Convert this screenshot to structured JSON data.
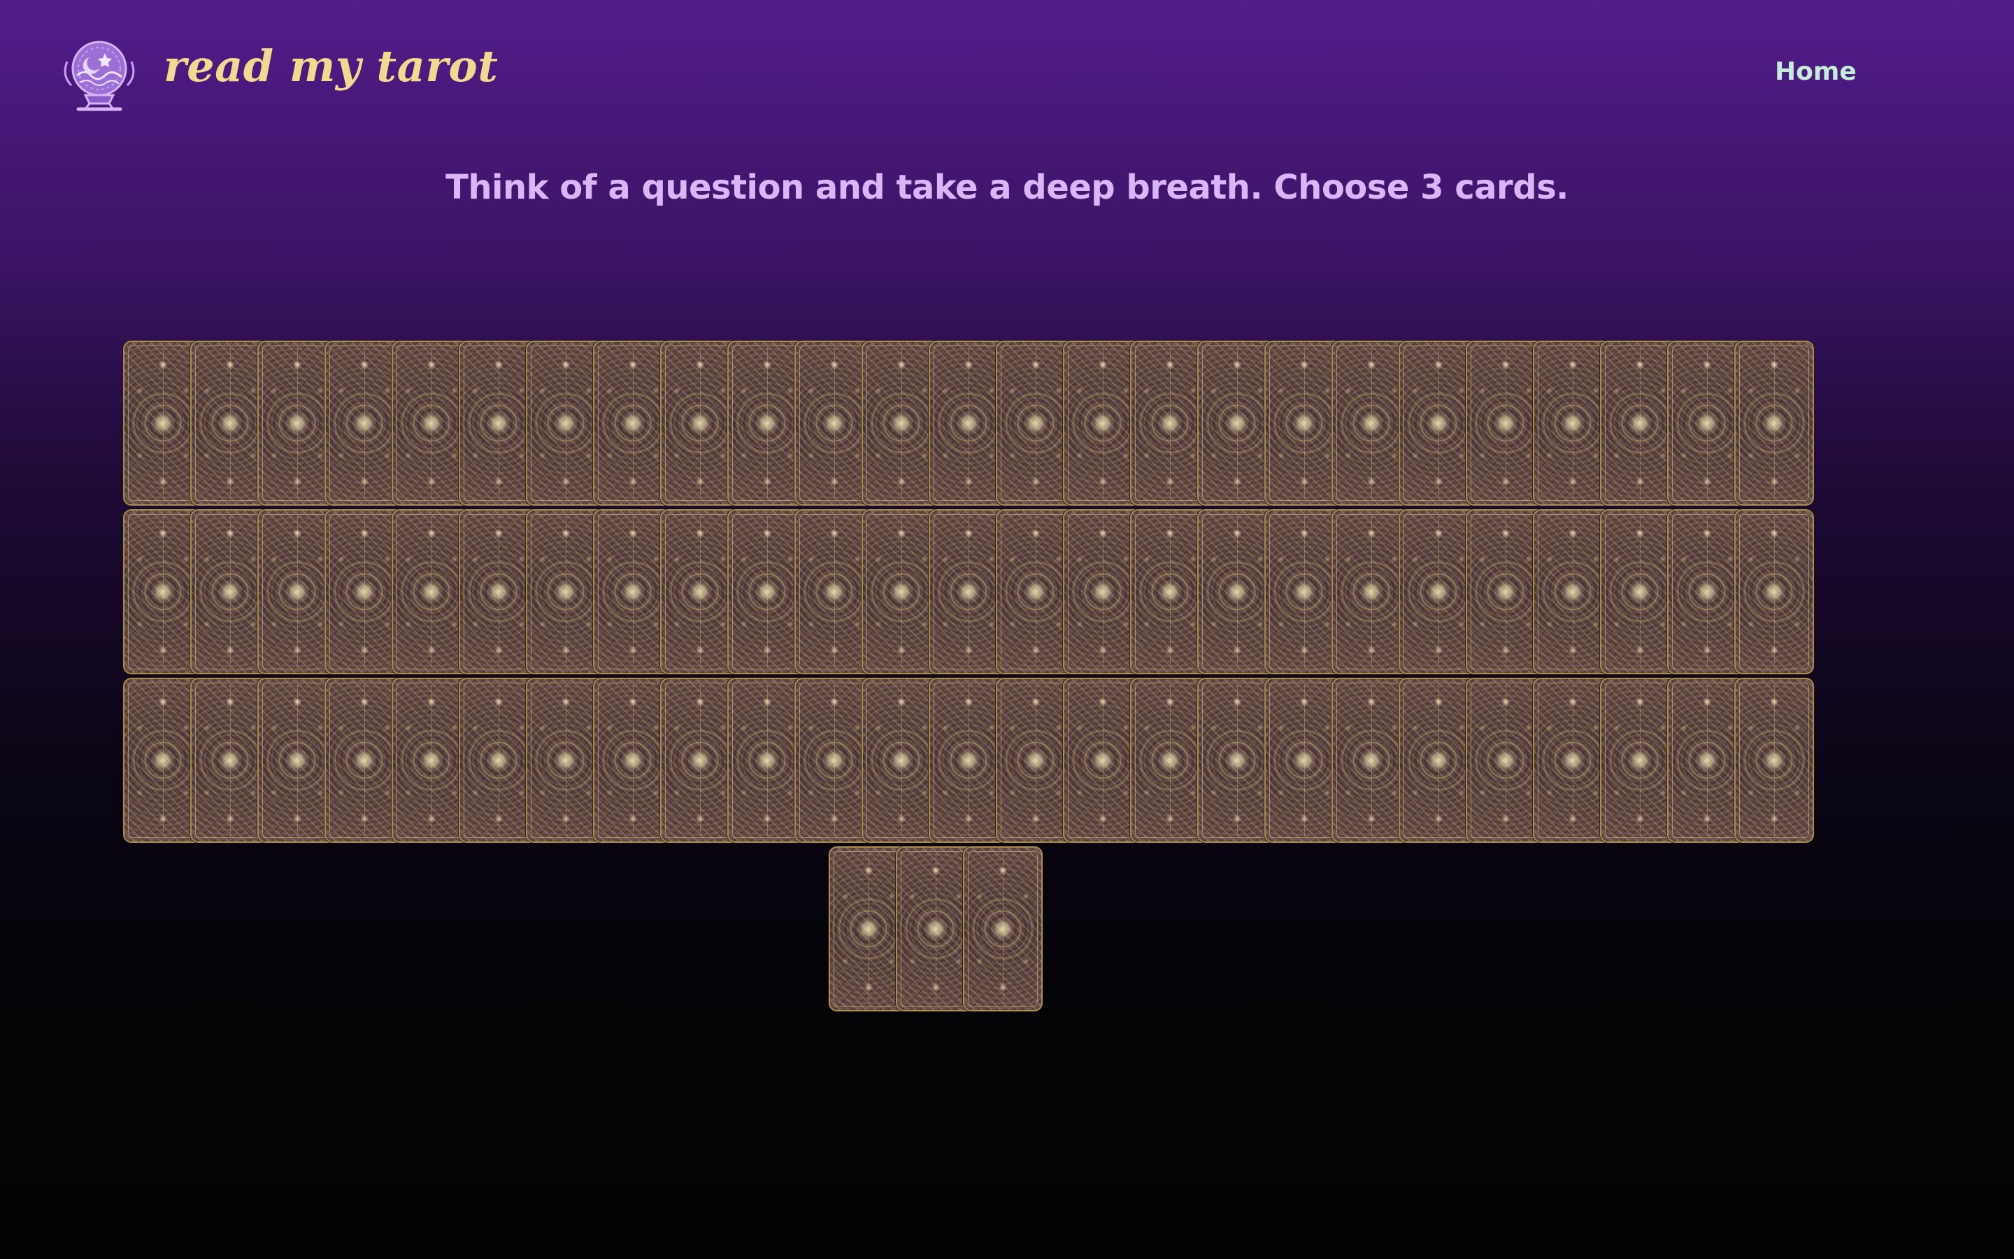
{
  "header": {
    "logo_icon": "crystal-ball-icon",
    "brand": "read my tarot",
    "nav": {
      "home": "Home"
    }
  },
  "main": {
    "prompt": "Think of a question and take a deep breath. Choose 3 cards."
  },
  "deck": {
    "card_count": 78,
    "card_label": "tarot-card-back"
  },
  "colors": {
    "brand": "#f3d98e",
    "nav_link": "#c4ecd9",
    "prompt": "#d9b6f5",
    "background_top": "#521c8a",
    "background_bottom": "#030305",
    "card_border": "#a98c52"
  }
}
